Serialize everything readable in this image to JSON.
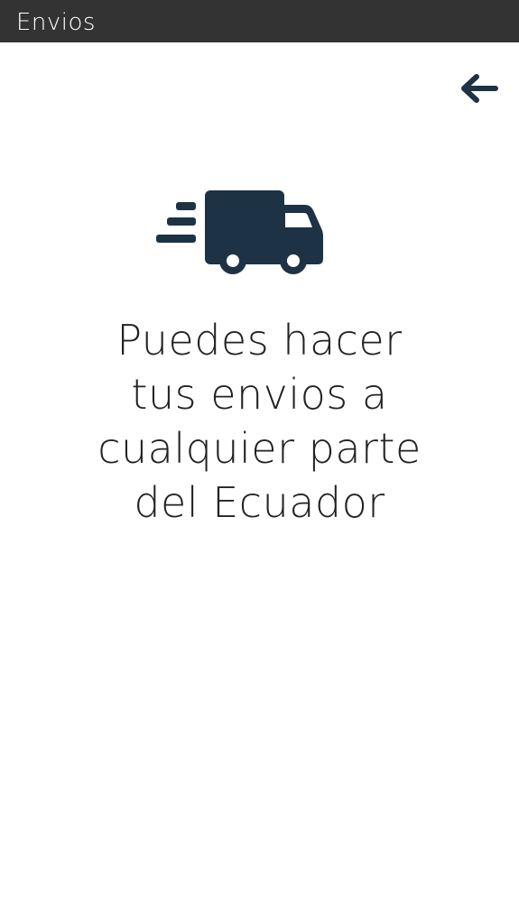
{
  "header": {
    "title": "Envios",
    "background": "#333333"
  },
  "toolbar": {
    "back_icon": "arrow-left-icon",
    "back_color": "#1e3245"
  },
  "hero": {
    "icon": "shipping-fast-truck-icon",
    "icon_color": "#1e3245",
    "lines": [
      "Puedes hacer",
      "tus envios a",
      "cualquier parte",
      "del Ecuador"
    ]
  }
}
